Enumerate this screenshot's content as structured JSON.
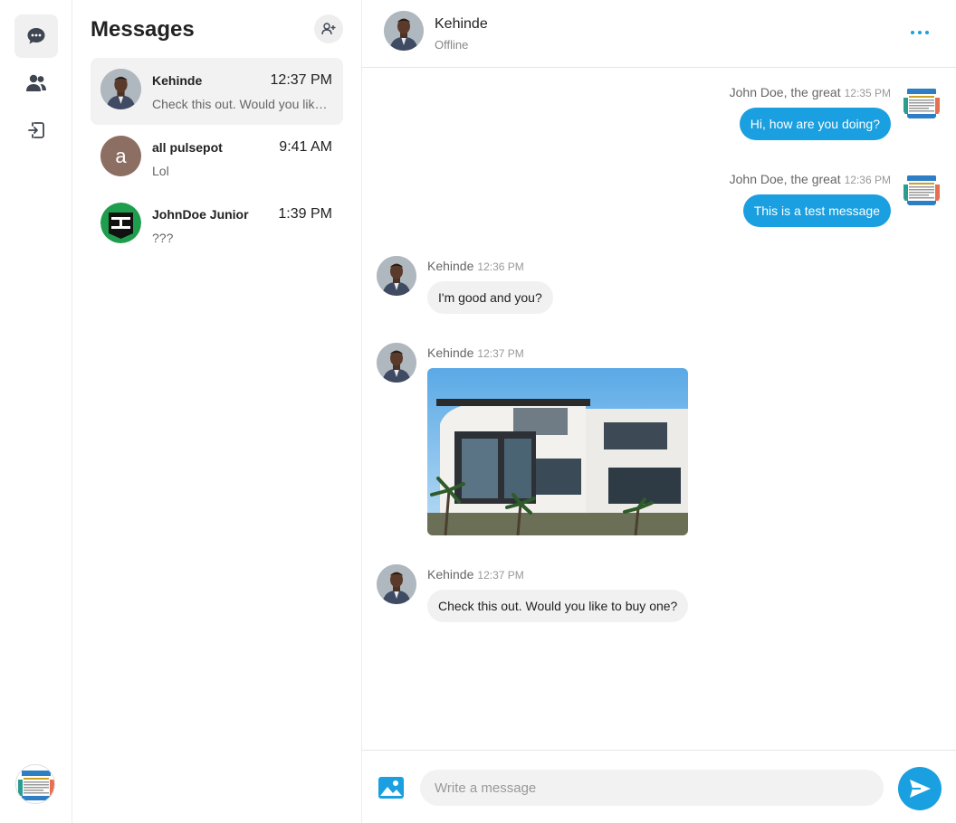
{
  "colors": {
    "accent": "#1a9fe0",
    "incoming_bubble": "#f1f1f1",
    "active_item": "#f2f2f2"
  },
  "rail": {
    "items": [
      {
        "icon": "chat-bubble-icon",
        "active": true
      },
      {
        "icon": "users-icon",
        "active": false
      },
      {
        "icon": "logout-icon",
        "active": false
      }
    ]
  },
  "conversations": {
    "title": "Messages",
    "add_icon": "add-contact-icon",
    "items": [
      {
        "name": "Kehinde",
        "time": "12:37 PM",
        "preview": "Check this out. Would you like to buy one?",
        "avatar": "photo",
        "active": true
      },
      {
        "name": "all pulsepot",
        "time": "9:41 AM",
        "preview": "Lol",
        "avatar": "a",
        "active": false
      },
      {
        "name": "JohnDoe Junior",
        "time": "1:39 PM",
        "preview": "???",
        "avatar": "logo",
        "active": false
      }
    ]
  },
  "chat": {
    "contact_name": "Kehinde",
    "status": "Offline",
    "messages": [
      {
        "sender": "John Doe, the great",
        "time": "12:35 PM",
        "text": "Hi, how are you doing?",
        "direction": "out"
      },
      {
        "sender": "John Doe, the great",
        "time": "12:36 PM",
        "text": "This is a test message",
        "direction": "out"
      },
      {
        "sender": "Kehinde",
        "time": "12:36 PM",
        "text": "I'm good and you?",
        "direction": "in"
      },
      {
        "sender": "Kehinde",
        "time": "12:37 PM",
        "text": "",
        "direction": "in",
        "attachment": "house-photo"
      },
      {
        "sender": "Kehinde",
        "time": "12:37 PM",
        "text": "Check this out. Would you like to buy one?",
        "direction": "in"
      }
    ]
  },
  "composer": {
    "placeholder": "Write a message",
    "image_icon": "image-icon",
    "send_icon": "send-icon"
  }
}
